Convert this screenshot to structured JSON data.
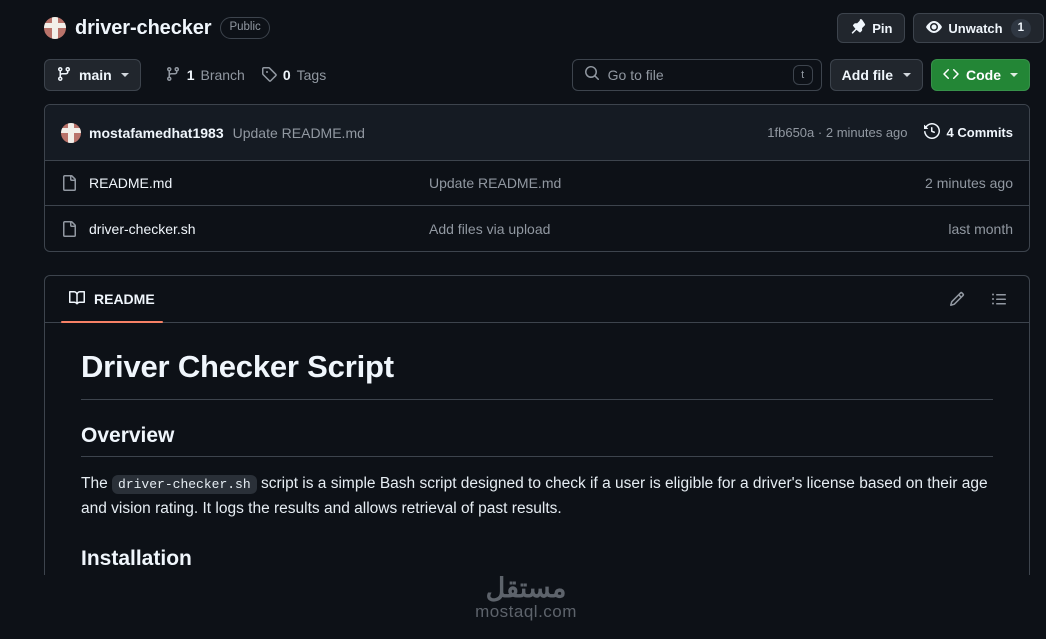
{
  "repo": {
    "name": "driver-checker",
    "visibility": "Public",
    "avatar_icon": "repo-owner-avatar"
  },
  "header_actions": {
    "pin_label": "Pin",
    "pin_icon": "pin-icon",
    "watch_label": "Unwatch",
    "watch_icon": "eye-icon",
    "watch_count": "1"
  },
  "toolbar": {
    "branch_label": "main",
    "branch_icon": "branch-icon",
    "branches_count": "1",
    "branches_label": "Branch",
    "tags_count": "0",
    "tags_label": "Tags",
    "tags_icon": "tag-icon",
    "search_placeholder": "Go to file",
    "search_icon": "search-icon",
    "search_kbd": "t",
    "add_file_label": "Add file",
    "code_label": "Code",
    "code_icon": "code-brackets-icon",
    "code_color": "#238636"
  },
  "commit_bar": {
    "author": "mostafamedhat1983",
    "message": "Update README.md",
    "sha": "1fb650a",
    "separator": "·",
    "relative_time": "2 minutes ago",
    "commits_count": "4 Commits",
    "history_icon": "history-clock-icon"
  },
  "files": {
    "rows": [
      {
        "icon": "file-icon",
        "name": "README.md",
        "message": "Update README.md",
        "time": "2 minutes ago"
      },
      {
        "icon": "file-icon",
        "name": "driver-checker.sh",
        "message": "Add files via upload",
        "time": "last month"
      }
    ]
  },
  "readme": {
    "tab_label": "README",
    "tab_icon": "book-icon",
    "edit_icon": "pencil-icon",
    "outline_icon": "list-outline-icon",
    "accent_color": "#f78166",
    "title": "Driver Checker Script",
    "overview_heading": "Overview",
    "paragraph_part1": "The",
    "paragraph_code": "driver-checker.sh",
    "paragraph_part2": "script is a simple Bash script designed to check if a user is eligible for a driver's license based on their age and vision rating. It logs the results and allows retrieval of past results.",
    "installation_heading": "Installation"
  },
  "watermark": {
    "arabic": "مستقل",
    "latin": "mostaql.com"
  }
}
